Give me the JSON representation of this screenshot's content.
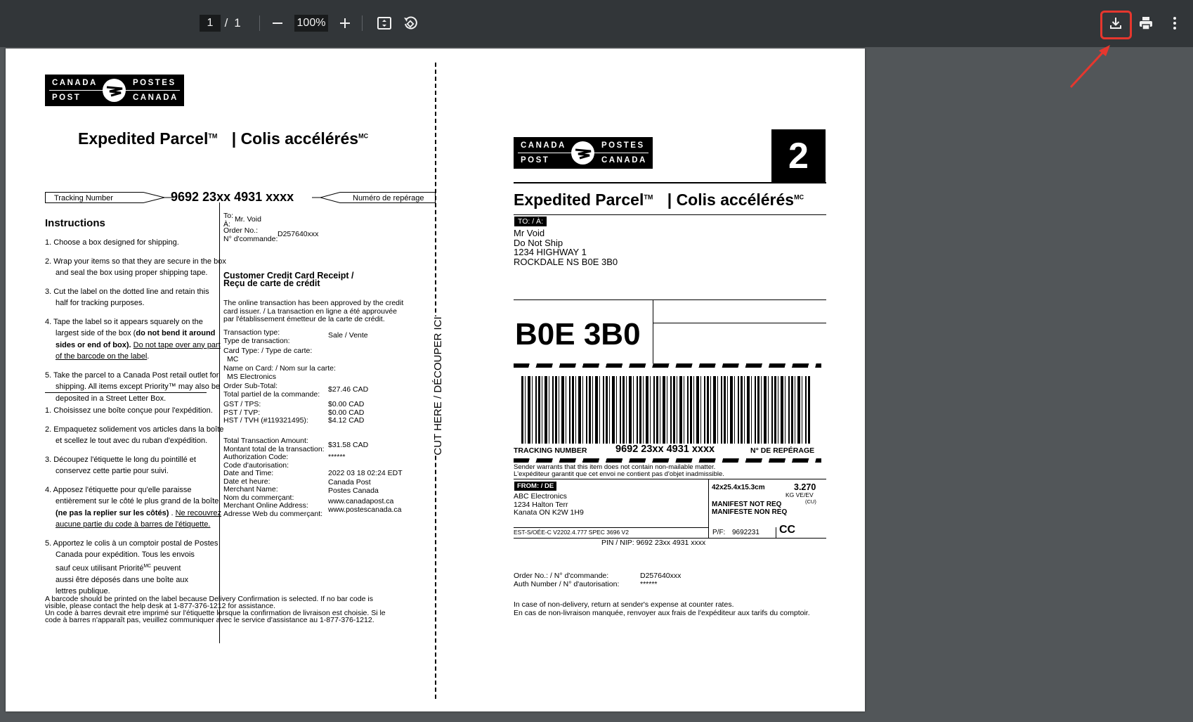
{
  "toolbar": {
    "current_page": "1",
    "page_separator": "/",
    "total_pages": "1",
    "zoom": "100%",
    "icons": [
      "minus-icon",
      "plus-icon",
      "fit-page-icon",
      "rotate-icon",
      "download-icon",
      "print-icon",
      "more-vert-icon"
    ],
    "highlight_color": "#e6372e"
  },
  "logo": {
    "canada": "CANADA",
    "postes": "POSTES",
    "post": "POST",
    "canada2": "CANADA"
  },
  "left": {
    "title_en": "Expedited Parcel",
    "title_en_mark": "TM",
    "title_fr": "| Colis accélérés",
    "title_fr_mark": "MC",
    "tracking_label_en": "Tracking Number",
    "tracking_number": "9692 23xx 4931 xxxx",
    "tracking_label_fr": "Numéro de repérage",
    "instructions_heading": "Instructions",
    "en_steps": {
      "s1": "1. Choose a box designed for shipping.",
      "s2a": "2. Wrap your items so that they are secure in the box",
      "s2b": "and seal the box using proper shipping tape.",
      "s3a": "3. Cut the label on the dotted line and retain this",
      "s3b": "half for tracking purposes.",
      "s4a": "4. Tape the label so it appears squarely on the",
      "s4b_pre": "largest side of the box (",
      "s4b_bold": "do not bend it around",
      "s4c_bold": "sides or end of box).",
      "s4c_under": "Do not tape over any part",
      "s4d_under": "of the barcode on the label",
      "s4d_end": ".",
      "s5a": "5. Take the parcel to a Canada Post retail outlet for",
      "s5b": "shipping. All items except Priority™ may also be",
      "s5c": "deposited in a Street Letter Box."
    },
    "fr_steps": {
      "s1": "1. Choisissez une boîte conçue pour l'expédition.",
      "s2a": "2. Empaquetez solidement vos articles dans la boîte",
      "s2b": "et scellez le tout avec du ruban d'expédition.",
      "s3a": "3. Découpez l'étiquette le long du pointillé et",
      "s3b": "conservez cette partie pour suivi.",
      "s4a": "4. Apposez l'étiquette pour qu'elle paraisse",
      "s4b": "entièrement sur le côté le plus grand de la boîte",
      "s4c_bold": "(ne pas la replier sur les côtés)",
      "s4c_mid": " . ",
      "s4c_under": "Ne recouvrez",
      "s4d_under": "aucune partie du code à barres de l'étiquette.",
      "s5a": "5. Apportez le colis à un comptoir postal de Postes",
      "s5b": "Canada pour expédition. Tous les envois",
      "s5c_pre": "sauf ceux utilisant Priorité",
      "s5c_mark": "MC",
      "s5c_post": " peuvent",
      "s5d": "aussi être déposés dans une boîte aux",
      "s5e": "lettres publique."
    },
    "to_labels": "To:",
    "to_fr": "À:",
    "to_name": "Mr. Void",
    "order_label_en": "Order No.:",
    "order_label_fr": "N° d'commande:",
    "order_no": "D257640xxx",
    "receipt_title_1": "Customer Credit Card Receipt /",
    "receipt_title_2": "Reçu de carte de crédit",
    "receipt_note_1": "The online transaction has been approved by the credit",
    "receipt_note_2": "card issuer. / La transaction en ligne a été approuvée",
    "receipt_note_3": "par l'établissement émetteur de la carte de crédit.",
    "txn_type_label": "Transaction type:",
    "txn_type_label_fr": "Type de transaction:",
    "txn_type_value": "Sale / Vente",
    "card_type_label": "Card Type: / Type de carte:",
    "card_type_value": "MC",
    "name_on_card_label": "Name on Card: / Nom sur la carte:",
    "name_on_card_value": "MS Electronics",
    "subtotal_label": "Order Sub-Total:",
    "subtotal_label_fr": "Total partiel de la commande:",
    "subtotal_value": "$27.46 CAD",
    "gst_label": "GST / TPS:",
    "pst_label": "PST / TVP:",
    "hst_label": "HST / TVH (#119321495):",
    "gst_value": "$0.00 CAD",
    "pst_value": "$0.00 CAD",
    "hst_value": "$4.12 CAD",
    "total_label": "Total Transaction Amount:",
    "total_label_fr": "Montant total de la transaction:",
    "total_value": "$31.58 CAD",
    "auth_label": "Authorization Code:",
    "auth_label_fr": "Code d'autorisation:",
    "auth_value": "******",
    "date_label": "Date and Time:",
    "date_label_fr": "Date et heure:",
    "date_value": "2022 03 18 02:24 EDT",
    "merchant_label": "Merchant Name:",
    "merchant_label_fr": "Nom du commerçant:",
    "merchant_value_1": "Canada Post",
    "merchant_value_2": "Postes Canada",
    "web_label": "Merchant Online Address:",
    "web_label_fr": "Adresse Web du commerçant:",
    "web_value_1": "www.canadapost.ca",
    "web_value_2": "www.postescanada.ca",
    "footnote_1": "A barcode should be printed on the label because Delivery Confirmation is selected. If no bar code is",
    "footnote_2": "visible, please contact the help desk at 1-877-376-1212 for assistance.",
    "footnote_3": "Un code à barres devrait etre imprimé sur l'étiquette lorsque la confirmation de livraison est choisie. Si le",
    "footnote_4": "code à barres n'apparaît pas, veuillez communiquer avec le service d'assistance au 1-877-376-1212.",
    "cut_here": "CUT HERE   /   DÉCOUPER ICI"
  },
  "right": {
    "big_number": "2",
    "title_en": "Expedited Parcel",
    "title_en_mark": "TM",
    "title_fr": "| Colis accélérés",
    "title_fr_mark": "MC",
    "to_tag": "TO: / À:",
    "addr_1": "Mr Void",
    "addr_2": "Do Not Ship",
    "addr_3": "1234 HIGHWAY 1",
    "addr_4": "ROCKDALE NS  B0E 3B0",
    "postal_big": "B0E 3B0",
    "tracking_label_en": "TRACKING NUMBER",
    "tracking_number": "9692 23xx 4931 xxxx",
    "tracking_label_fr": "N° DE REPÉRAGE",
    "warrant_1": "Sender warrants that this item does not contain non-mailable matter.",
    "warrant_2": "L'expéditeur garantit que cet envoi ne contient pas d'objet inadmissible.",
    "from_tag": "FROM: / DE",
    "from_1": "ABC Electronics",
    "from_2": "1234 Halton Terr",
    "from_3": "Kanata ON  K2W 1H9",
    "dims": "42x25.4x15.3cm",
    "weight": "3.270",
    "weight_unit": "KG VE/EV",
    "weight_cu": "(CU)",
    "manifest_en": "MANIFEST NOT REQ",
    "manifest_fr": "MANIFESTE NON REQ",
    "est_code": "EST-S/OÉE-C V2202.4.777   SPEC 3696 V2",
    "pf_label": "P/F:",
    "pf_value": "9692231",
    "cc": "CC",
    "pin": "PIN / NIP:  9692 23xx 4931 xxxx",
    "order_label": "Order No.: / N° d'commande:",
    "order_value": "D257640xxx",
    "auth_label": "Auth Number / N° d'autorisation:",
    "auth_value": "******",
    "nondeliv_1": "In case of non-delivery, return at sender's expense at counter rates.",
    "nondeliv_2": "En cas de non-livraison manquée, renvoyer aux frais de l'expéditeur aux tarifs du comptoir."
  }
}
